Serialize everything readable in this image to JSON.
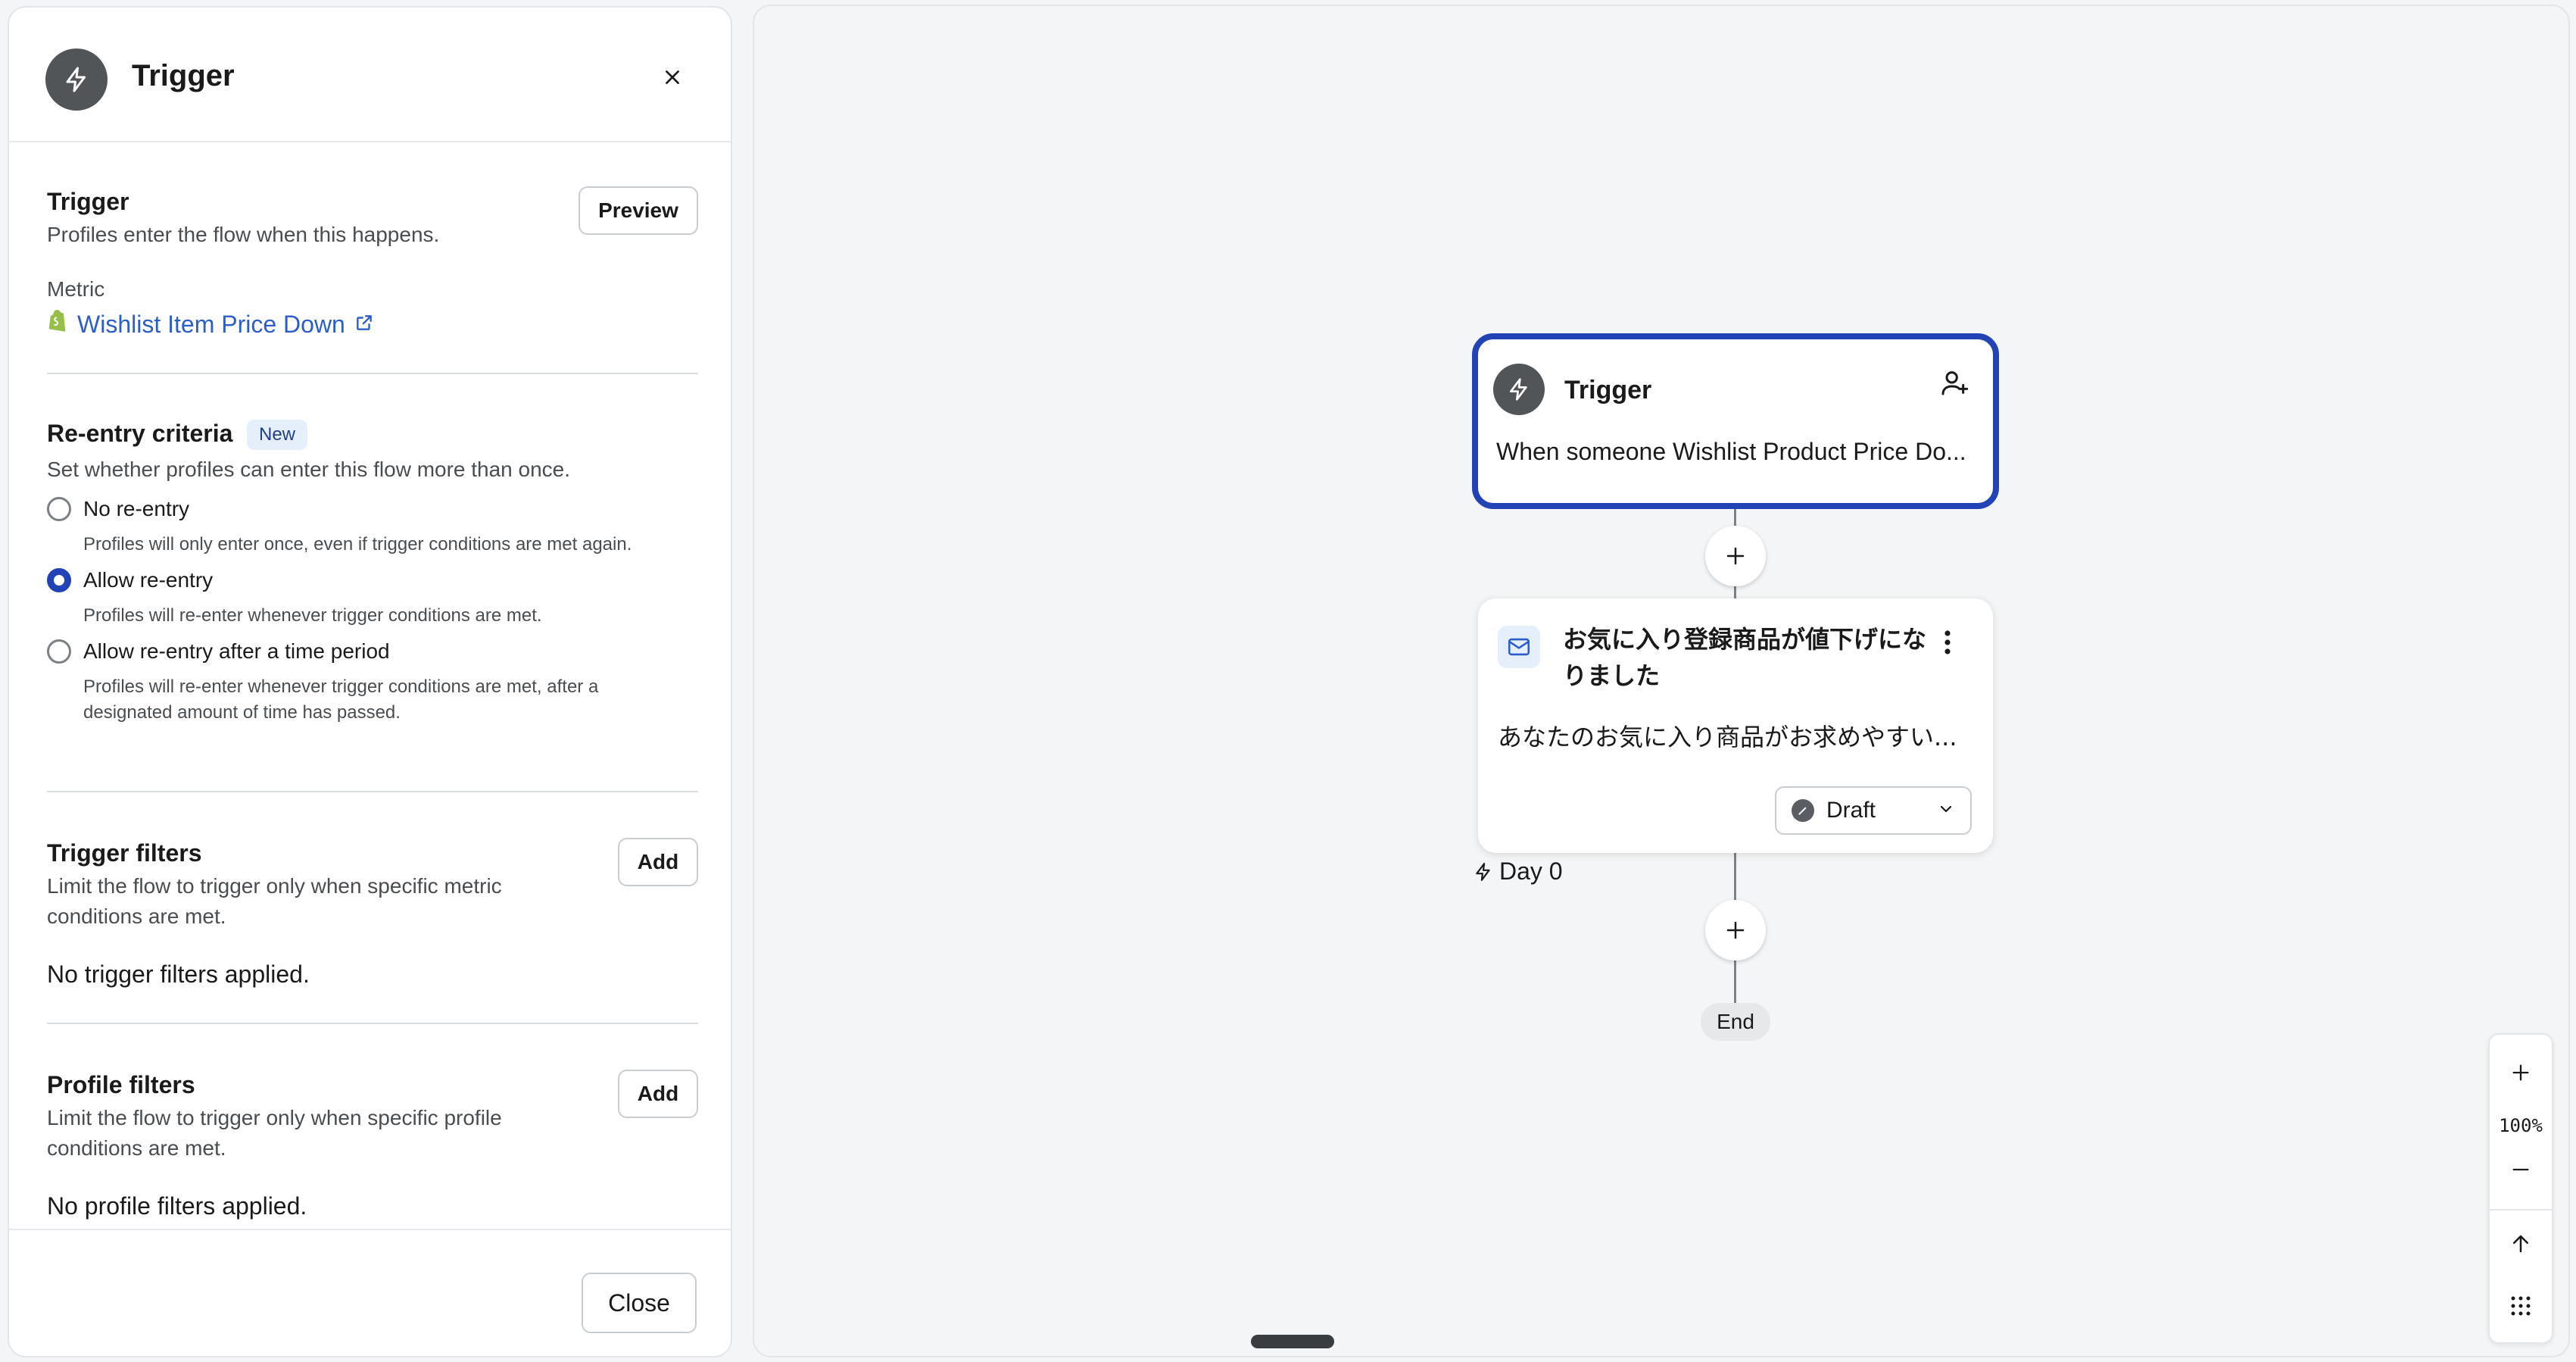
{
  "panel": {
    "title": "Trigger",
    "trigger_section": {
      "title": "Trigger",
      "description": "Profiles enter the flow when this happens.",
      "preview_label": "Preview",
      "metric_label": "Metric",
      "metric_name": "Wishlist Item Price Down"
    },
    "reentry": {
      "title": "Re-entry criteria",
      "badge": "New",
      "description": "Set whether profiles can enter this flow more than once.",
      "options": [
        {
          "label": "No re-entry",
          "help": "Profiles will only enter once, even if trigger conditions are met again.",
          "selected": false
        },
        {
          "label": "Allow re-entry",
          "help": "Profiles will re-enter whenever trigger conditions are met.",
          "selected": true
        },
        {
          "label": "Allow re-entry after a time period",
          "help": "Profiles will re-enter whenever trigger conditions are met, after a designated amount of time has passed.",
          "selected": false
        }
      ]
    },
    "trigger_filters": {
      "title": "Trigger filters",
      "description": "Limit the flow to trigger only when specific metric conditions are met.",
      "add_label": "Add",
      "empty": "No trigger filters applied."
    },
    "profile_filters": {
      "title": "Profile filters",
      "description": "Limit the flow to trigger only when specific profile conditions are met.",
      "add_label": "Add",
      "empty": "No profile filters applied."
    },
    "close_label": "Close"
  },
  "canvas": {
    "trigger_node": {
      "title": "Trigger",
      "description": "When someone Wishlist Product Price Do..."
    },
    "email_node": {
      "title": "お気に入り登録商品が値下げになりました",
      "preview": "あなたのお気に入り商品がお求めやすい...",
      "status": "Draft"
    },
    "day_label": "Day 0",
    "end_label": "End",
    "zoom": "100%"
  },
  "colors": {
    "accent": "#2243b6",
    "link": "#2b5ec9",
    "icon_dark": "#515558",
    "badge_bg": "#e5eefb",
    "shopify_green": "#95bf47"
  },
  "icons": [
    "bolt-icon",
    "close-icon",
    "shopify-icon",
    "external-link-icon",
    "add-person-icon",
    "plus-icon",
    "mail-icon",
    "kebab-menu-icon",
    "edit-icon",
    "chevron-down-icon",
    "minus-icon",
    "arrow-up-icon",
    "grid-icon"
  ]
}
